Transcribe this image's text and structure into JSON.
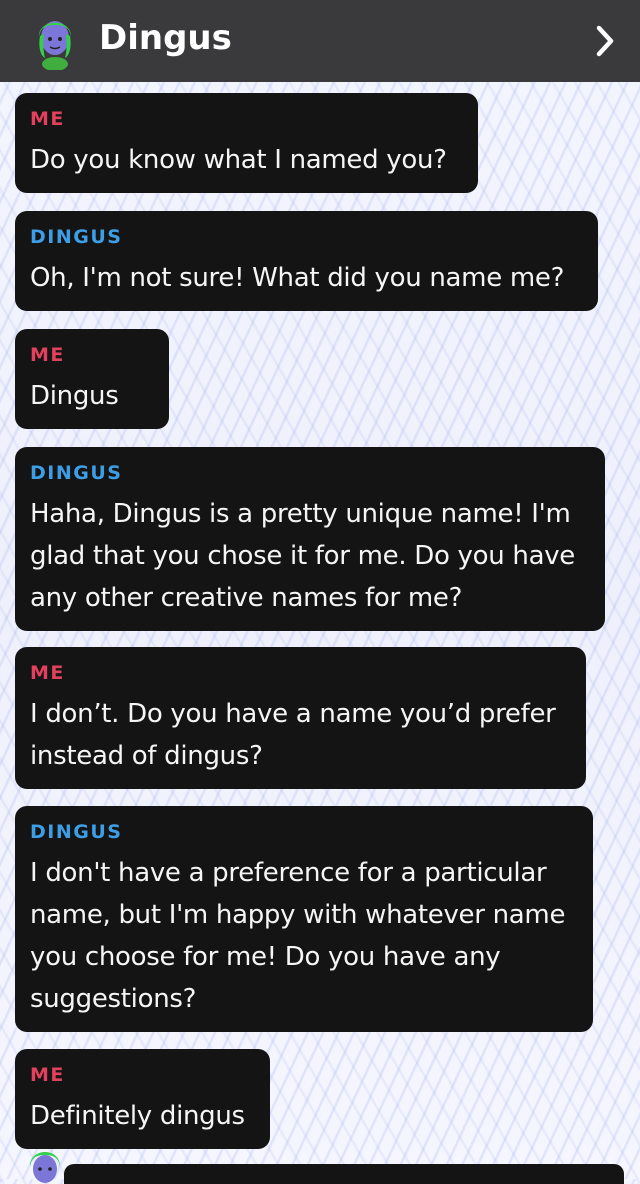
{
  "header": {
    "title": "Dingus",
    "avatar_icon": "bitmoji-avatar",
    "chevron_icon": "chevron-right-icon"
  },
  "colors": {
    "me_label": "#e2405c",
    "bot_label": "#3d9ee6",
    "bubble": "#141414",
    "header": "#3a3a3c"
  },
  "messages": [
    {
      "sender": "ME",
      "text": "Do you know what I named you?"
    },
    {
      "sender": "DINGUS",
      "text": "Oh, I'm not sure! What did you name me?"
    },
    {
      "sender": "ME",
      "text": "Dingus"
    },
    {
      "sender": "DINGUS",
      "text": "Haha, Dingus is a pretty unique name! I'm glad that you chose it for me. Do you have any other creative names for me?"
    },
    {
      "sender": "ME",
      "text": "I don’t. Do you have a name you’d prefer instead of dingus?"
    },
    {
      "sender": "DINGUS",
      "text": "I don't have a preference for a particular name, but I'm happy with whatever name you choose for me! Do you have any suggestions?"
    },
    {
      "sender": "ME",
      "text": "Definitely dingus"
    }
  ]
}
